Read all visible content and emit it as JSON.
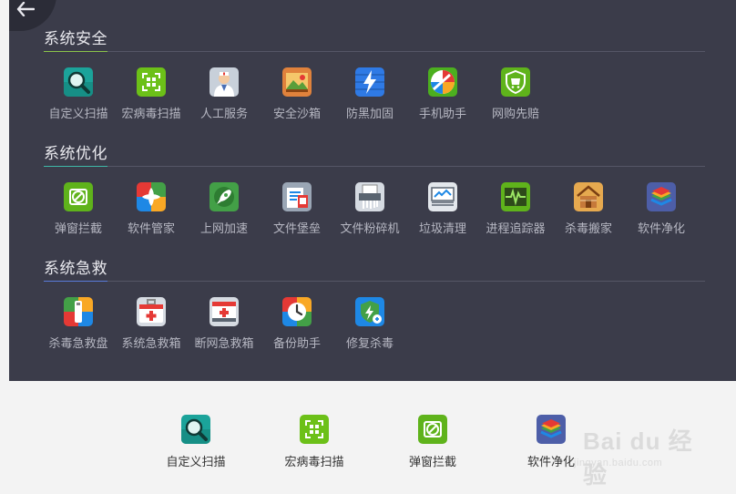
{
  "sections": [
    {
      "title": "系统安全",
      "accent": "#8bc34a",
      "tools": [
        {
          "label": "自定义扫描",
          "icon": "magnifier-scan-icon"
        },
        {
          "label": "宏病毒扫描",
          "icon": "qr-scan-icon"
        },
        {
          "label": "人工服务",
          "icon": "doctor-service-icon"
        },
        {
          "label": "安全沙箱",
          "icon": "sandbox-picture-icon"
        },
        {
          "label": "防黑加固",
          "icon": "lightning-shield-icon"
        },
        {
          "label": "手机助手",
          "icon": "phone-assistant-icon"
        },
        {
          "label": "网购先赔",
          "icon": "shopping-shield-icon"
        }
      ]
    },
    {
      "title": "系统优化",
      "accent": "#3fb9a8",
      "tools": [
        {
          "label": "弹窗拦截",
          "icon": "popup-block-icon"
        },
        {
          "label": "软件管家",
          "icon": "software-manager-icon"
        },
        {
          "label": "上网加速",
          "icon": "rocket-icon"
        },
        {
          "label": "文件堡垒",
          "icon": "file-fortress-icon"
        },
        {
          "label": "文件粉碎机",
          "icon": "file-shredder-icon"
        },
        {
          "label": "垃圾清理",
          "icon": "trash-clean-icon"
        },
        {
          "label": "进程追踪器",
          "icon": "process-monitor-icon"
        },
        {
          "label": "杀毒搬家",
          "icon": "house-move-icon"
        },
        {
          "label": "软件净化",
          "icon": "layers-icon"
        }
      ]
    },
    {
      "title": "系统急救",
      "accent": "#5a7bd8",
      "tools": [
        {
          "label": "杀毒急救盘",
          "icon": "usb-rescue-icon"
        },
        {
          "label": "系统急救箱",
          "icon": "first-aid-kit-icon"
        },
        {
          "label": "断网急救箱",
          "icon": "network-rescue-kit-icon"
        },
        {
          "label": "备份助手",
          "icon": "backup-clock-icon"
        },
        {
          "label": "修复杀毒",
          "icon": "repair-shield-icon"
        }
      ]
    }
  ],
  "pinned": [
    {
      "label": "自定义扫描",
      "icon": "magnifier-scan-icon"
    },
    {
      "label": "宏病毒扫描",
      "icon": "qr-scan-icon"
    },
    {
      "label": "弹窗拦截",
      "icon": "popup-block-icon"
    },
    {
      "label": "软件净化",
      "icon": "layers-icon"
    }
  ],
  "watermark": {
    "brand": "Bai du 经验",
    "url": "jingyan.baidu.com"
  },
  "colors": {
    "panel": "#3b3c4a",
    "footer": "#f3f3f3",
    "label": "#b6b7c2",
    "title": "#e9e9ee"
  }
}
